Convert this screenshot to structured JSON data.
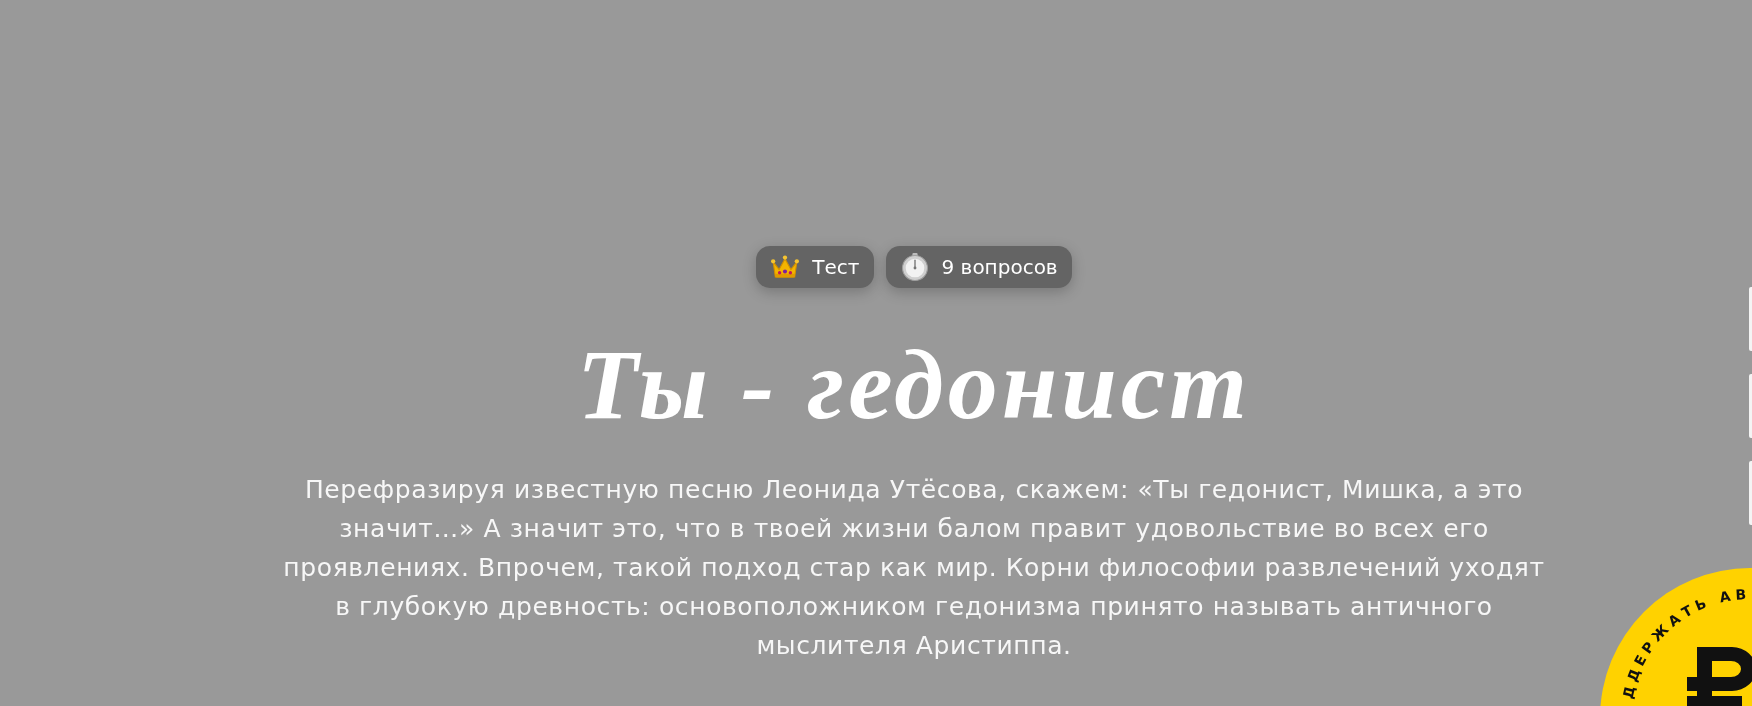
{
  "tags": [
    {
      "kind": "test",
      "label": "Тест"
    },
    {
      "kind": "questions",
      "label": "9 вопросов"
    }
  ],
  "title": "Ты - гедонист",
  "description": "Перефразируя известную песню Леонида Утёсова, скажем: «Ты гедонист, Мишка, а это значит…» А значит это, что в твоей жизни балом правит удовольствие во всех его проявлениях. Впрочем, такой подход стар как мир. Корни философии развлечений уходят в глубокую древность: основоположником гедонизма принято называть античного мыслителя Аристиппа.",
  "support_badge": {
    "text": "ДДЕРЖАТЬ АВ"
  }
}
